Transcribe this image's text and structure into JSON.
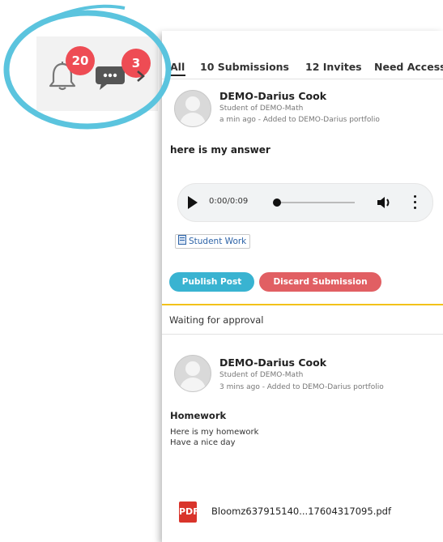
{
  "notifications": {
    "bell_count": "20",
    "chat_count": "3"
  },
  "tabs": [
    "All",
    "10 Submissions",
    "12 Invites",
    "Need Access"
  ],
  "post1": {
    "author": "DEMO-Darius Cook",
    "role": "Student of DEMO-Math",
    "meta": "a min ago - Added to DEMO-Darius portfolio",
    "text": "here is my answer",
    "audio_time": "0:00/0:09",
    "tag": "Student Work",
    "publish_label": "Publish Post",
    "discard_label": "Discard Submission",
    "status": "Waiting for approval"
  },
  "post2": {
    "author": "DEMO-Darius Cook",
    "role": "Student of DEMO-Math",
    "meta": "3 mins ago - Added to DEMO-Darius portfolio",
    "title": "Homework",
    "line1": "Here is my homework",
    "line2": "Have a nice day",
    "attachment_icon": "PDF",
    "attachment": "Bloomz637915140...17604317095.pdf"
  },
  "colors": {
    "accent_blue": "#39b3d1",
    "discard_red": "#e15f63",
    "badge_red": "#ee4c54",
    "approval_yellow": "#f2c21a",
    "highlight_ring": "#5bc4de"
  }
}
